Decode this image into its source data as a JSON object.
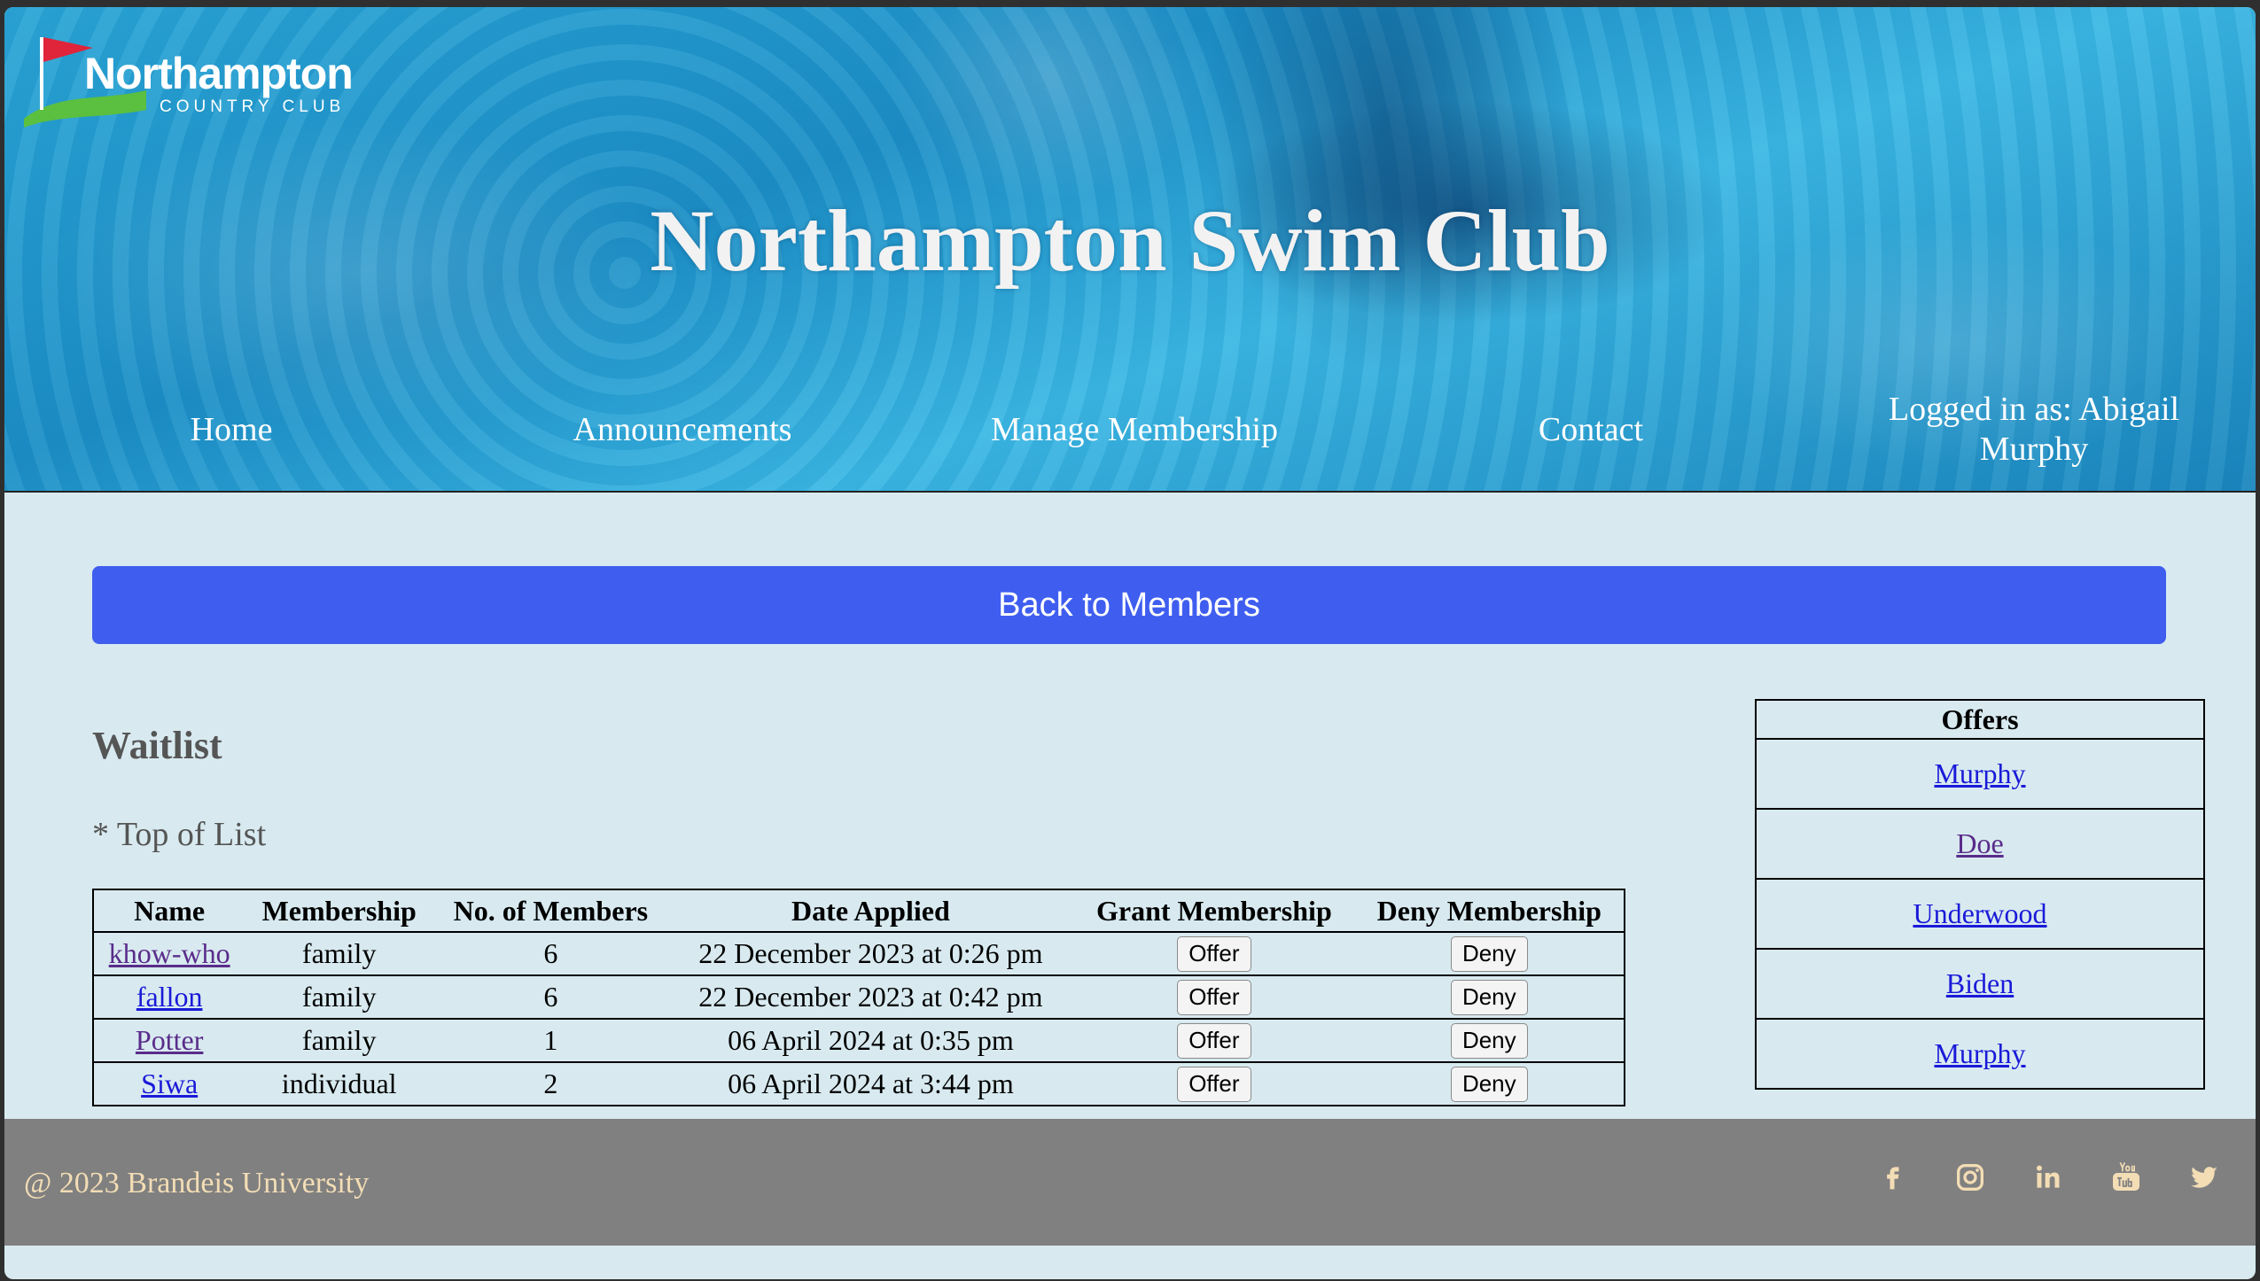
{
  "header": {
    "logo": {
      "name": "Northampton",
      "subtitle": "COUNTRY CLUB"
    },
    "site_title": "Northampton Swim Club",
    "nav": {
      "home": "Home",
      "announcements": "Announcements",
      "manage_membership": "Manage Membership",
      "contact": "Contact",
      "logged_in_line1": "Logged in as: Abigail",
      "logged_in_line2": "Murphy"
    }
  },
  "main": {
    "back_button": "Back to Members",
    "waitlist_title": "Waitlist",
    "top_note": "* Top of List",
    "waitlist_table": {
      "headers": [
        "Name",
        "Membership",
        "No. of Members",
        "Date Applied",
        "Grant Membership",
        "Deny Membership"
      ],
      "rows": [
        {
          "name": "khow-who",
          "membership": "family",
          "members": "6",
          "date": "22 December 2023 at 0:26 pm",
          "grant": "Offer",
          "deny": "Deny"
        },
        {
          "name": "fallon",
          "membership": "family",
          "members": "6",
          "date": "22 December 2023 at 0:42 pm",
          "grant": "Offer",
          "deny": "Deny"
        },
        {
          "name": "Potter",
          "membership": "family",
          "members": "1",
          "date": "06 April 2024 at 0:35 pm",
          "grant": "Offer",
          "deny": "Deny"
        },
        {
          "name": "Siwa",
          "membership": "individual",
          "members": "2",
          "date": "06 April 2024 at 3:44 pm",
          "grant": "Offer",
          "deny": "Deny"
        }
      ]
    },
    "offers": {
      "header": "Offers",
      "items": [
        "Murphy",
        "Doe",
        "Underwood",
        "Biden",
        "Murphy"
      ]
    }
  },
  "footer": {
    "copyright": "@ 2023 Brandeis University",
    "social_icons": [
      "facebook-icon",
      "instagram-icon",
      "linkedin-icon",
      "youtube-icon",
      "twitter-icon"
    ]
  },
  "colors": {
    "accent_button": "#3f5ef0",
    "page_background": "#d8eaf0",
    "footer_background": "#808080",
    "footer_text": "#f3ddb5"
  }
}
